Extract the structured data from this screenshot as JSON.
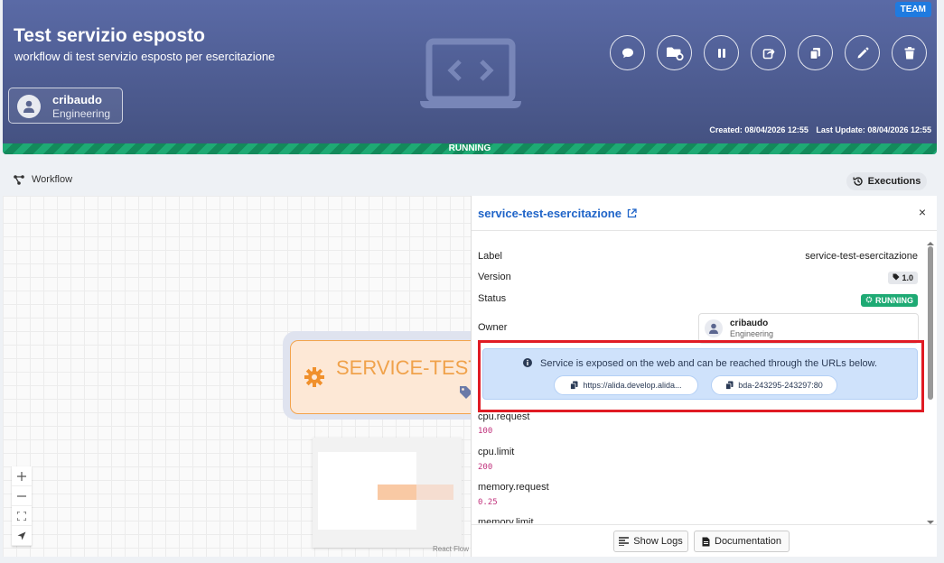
{
  "header": {
    "badge": "TEAM",
    "title": "Test servizio esposto",
    "subtitle": "workflow di test servizio esposto per esercitazione",
    "owner": {
      "name": "cribaudo",
      "team": "Engineering"
    },
    "created": "Created: 08/04/2026 12:55",
    "updated": "Last Update: 08/04/2026 12:55",
    "status": "RUNNING",
    "actions": [
      "comment-icon",
      "folder-settings-icon",
      "pause-icon",
      "share-icon",
      "copy-icon",
      "edit-icon",
      "delete-icon"
    ]
  },
  "section": {
    "workflow_label": "Workflow",
    "executions_label": "Executions"
  },
  "canvas": {
    "node_label": "SERVICE-TEST-",
    "attribution": "React Flow",
    "zoom_controls": [
      "+",
      "—",
      "fit",
      "lock"
    ]
  },
  "panel": {
    "title": "service-test-esercitazione",
    "fields": {
      "label_key": "Label",
      "label_val": "service-test-esercitazione",
      "version_key": "Version",
      "version_val": "1.0",
      "status_key": "Status",
      "status_val": "RUNNING",
      "owner_key": "Owner",
      "owner_name": "cribaudo",
      "owner_team": "Engineering"
    },
    "alert": {
      "message": "Service is exposed on the web and can be reached through the URLs below.",
      "url1": "https://alida.develop.alida...",
      "url2": "bda-243295-243297:80"
    },
    "params": [
      {
        "key": "cpu.request",
        "value": "100"
      },
      {
        "key": "cpu.limit",
        "value": "200"
      },
      {
        "key": "memory.request",
        "value": "0.25"
      },
      {
        "key": "memory.limit",
        "value": ""
      }
    ],
    "footer": {
      "logs": "Show Logs",
      "docs": "Documentation"
    }
  },
  "colors": {
    "header": "#4b5a92",
    "running": "#1eaa74",
    "accent": "#1f64c8",
    "highlight": "#e01b24",
    "node": "#f0a24b"
  }
}
